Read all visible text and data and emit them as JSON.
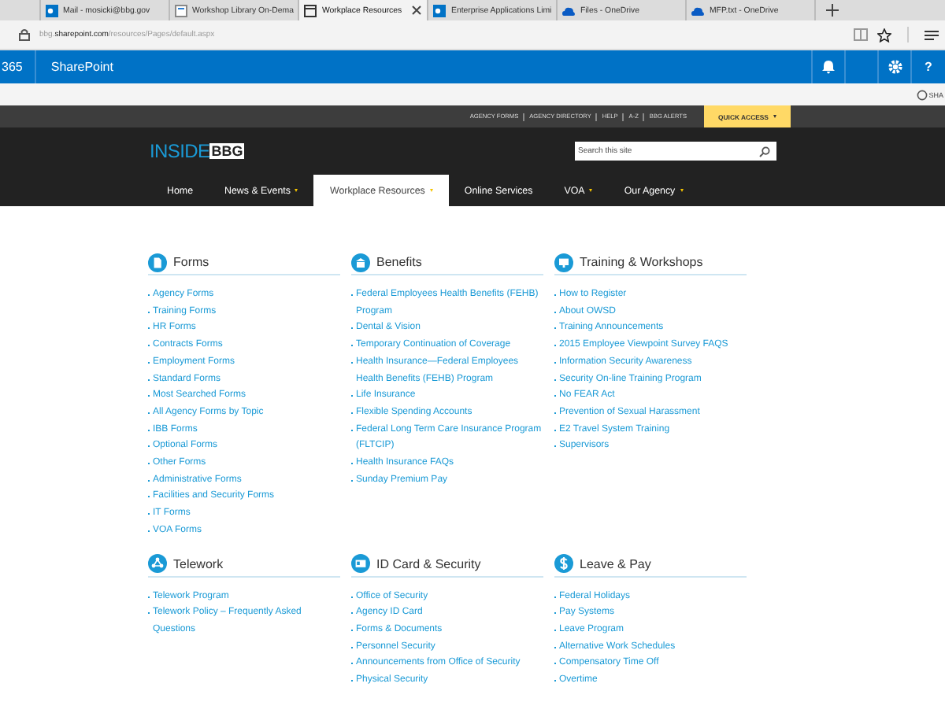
{
  "browser": {
    "tabs": [
      {
        "title": "Mail - mosicki@bbg.gov",
        "kind": "outlook",
        "selected": false
      },
      {
        "title": "Workshop Library On-Dema",
        "kind": "page",
        "selected": false
      },
      {
        "title": "Workplace Resources",
        "kind": "window",
        "selected": true
      },
      {
        "title": "Enterprise Applications Limi",
        "kind": "outlook",
        "selected": false
      },
      {
        "title": "Files - OneDrive",
        "kind": "cloud",
        "selected": false
      },
      {
        "title": "MFP.txt - OneDrive",
        "kind": "cloud",
        "selected": false
      }
    ],
    "address": {
      "domain_prefix": "bbg.",
      "domain": "sharepoint.com",
      "path": "/resources/Pages/default.aspx"
    }
  },
  "suite_bar": {
    "product": "365",
    "app": "SharePoint",
    "help": "?"
  },
  "share_strip": {
    "label": "SHA"
  },
  "utility_links": [
    "AGENCY FORMS",
    "AGENCY DIRECTORY",
    "HELP",
    "A-Z",
    "BBG ALERTS"
  ],
  "quick_access": {
    "label": "QUICK ACCESS"
  },
  "logo": {
    "part_1": "INSIDE",
    "part_2": "BBG"
  },
  "search": {
    "placeholder": "Search this site"
  },
  "nav": [
    {
      "label": "Home",
      "dropdown": false,
      "selected": false
    },
    {
      "label": "News & Events",
      "dropdown": true,
      "selected": false
    },
    {
      "label": "Workplace Resources",
      "dropdown": true,
      "selected": true
    },
    {
      "label": "Online Services",
      "dropdown": false,
      "selected": false
    },
    {
      "label": "VOA",
      "dropdown": true,
      "selected": false
    },
    {
      "label": "Our Agency",
      "dropdown": true,
      "selected": false
    }
  ],
  "sections": [
    {
      "title": "Forms",
      "kind": "document",
      "links": [
        "Agency Forms",
        "Training Forms",
        "HR Forms",
        "Contracts Forms",
        "Employment Forms",
        "Standard Forms",
        "Most Searched Forms",
        "All Agency Forms by Topic",
        "IBB Forms",
        "Optional Forms",
        "Other Forms",
        "Administrative Forms",
        "Facilities and Security Forms",
        "IT Forms",
        "VOA Forms"
      ]
    },
    {
      "title": "Benefits",
      "kind": "building",
      "links": [
        "Federal Employees Health Benefits (FEHB) Program",
        "Dental & Vision",
        "Temporary Continuation of Coverage",
        "Health Insurance—Federal Employees Health Benefits (FEHB) Program",
        "Life Insurance",
        "Flexible Spending Accounts",
        "Federal Long Term Care Insurance Program (FLTCIP)",
        "Health Insurance FAQs",
        "Sunday Premium Pay"
      ]
    },
    {
      "title": "Training & Workshops",
      "kind": "screen",
      "links": [
        "How to Register",
        "About OWSD",
        "Training Announcements",
        "2015 Employee Viewpoint Survey FAQS",
        "Information Security Awareness",
        "Security On-line Training Program",
        "No FEAR Act",
        "Prevention of Sexual Harassment",
        "E2 Travel System Training",
        "Supervisors"
      ]
    },
    {
      "title": "Telework",
      "kind": "network",
      "links": [
        "Telework Program",
        "Telework Policy – Frequently Asked Questions"
      ]
    },
    {
      "title": "ID Card & Security",
      "kind": "card",
      "links": [
        "Office of Security",
        "Agency ID Card",
        "Forms & Documents",
        "Personnel Security",
        "Announcements from Office of Security",
        "Physical Security"
      ]
    },
    {
      "title": "Leave & Pay",
      "kind": "dollar",
      "links": [
        "Federal Holidays",
        "Pay Systems",
        "Leave Program",
        "Alternative Work Schedules",
        "Compensatory Time Off",
        "Overtime"
      ]
    }
  ]
}
